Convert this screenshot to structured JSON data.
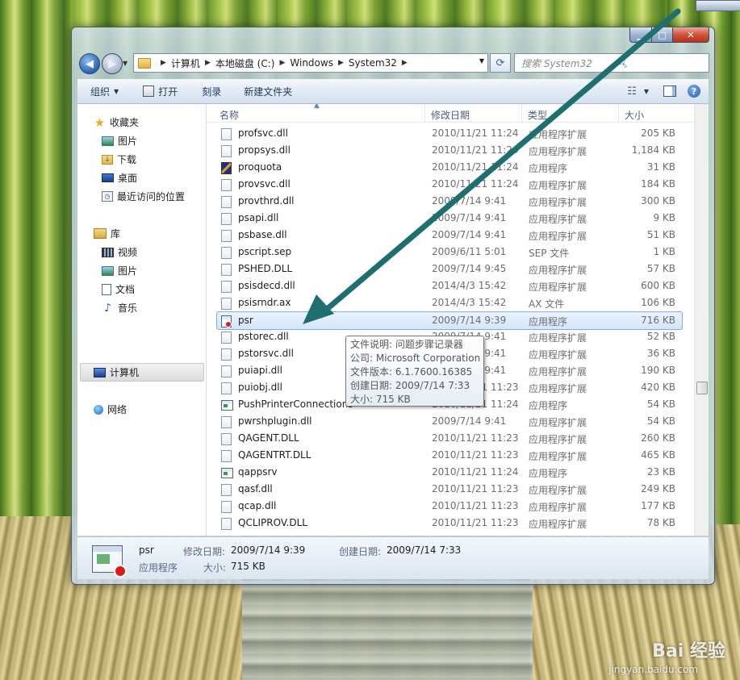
{
  "window": {
    "min_symbol": "▁",
    "max_symbol": "□",
    "close_symbol": "✕"
  },
  "address": {
    "crumbs": [
      "计算机",
      "本地磁盘 (C:)",
      "Windows",
      "System32"
    ],
    "search_placeholder": "搜索 System32"
  },
  "toolbar": {
    "organize": "组织",
    "open": "打开",
    "burn": "刻录",
    "new_folder": "新建文件夹"
  },
  "nav": {
    "favorites": "收藏夹",
    "fav_items": [
      "图片",
      "下载",
      "桌面",
      "最近访问的位置"
    ],
    "libraries": "库",
    "lib_items": [
      "视频",
      "图片",
      "文档",
      "音乐"
    ],
    "computer": "计算机",
    "network": "网络"
  },
  "columns": {
    "name": "名称",
    "date": "修改日期",
    "type": "类型",
    "size": "大小"
  },
  "files": [
    {
      "name": "profsvc.dll",
      "date": "2010/11/21 11:24",
      "type": "应用程序扩展",
      "size": "205 KB",
      "icon": "dll"
    },
    {
      "name": "propsys.dll",
      "date": "2010/11/21 11:24",
      "type": "应用程序扩展",
      "size": "1,184 KB",
      "icon": "dll"
    },
    {
      "name": "proquota",
      "date": "2010/11/21 11:24",
      "type": "应用程序",
      "size": "31 KB",
      "icon": "quota"
    },
    {
      "name": "provsvc.dll",
      "date": "2010/11/21 11:24",
      "type": "应用程序扩展",
      "size": "184 KB",
      "icon": "dll"
    },
    {
      "name": "provthrd.dll",
      "date": "2009/7/14 9:41",
      "type": "应用程序扩展",
      "size": "300 KB",
      "icon": "dll"
    },
    {
      "name": "psapi.dll",
      "date": "2009/7/14 9:41",
      "type": "应用程序扩展",
      "size": "9 KB",
      "icon": "dll"
    },
    {
      "name": "psbase.dll",
      "date": "2009/7/14 9:41",
      "type": "应用程序扩展",
      "size": "51 KB",
      "icon": "dll"
    },
    {
      "name": "pscript.sep",
      "date": "2009/6/11 5:01",
      "type": "SEP 文件",
      "size": "1 KB",
      "icon": "file"
    },
    {
      "name": "PSHED.DLL",
      "date": "2009/7/14 9:45",
      "type": "应用程序扩展",
      "size": "57 KB",
      "icon": "dll"
    },
    {
      "name": "psisdecd.dll",
      "date": "2014/4/3 15:42",
      "type": "应用程序扩展",
      "size": "600 KB",
      "icon": "dll"
    },
    {
      "name": "psisrndr.ax",
      "date": "2014/4/3 15:42",
      "type": "AX 文件",
      "size": "106 KB",
      "icon": "file"
    },
    {
      "name": "psr",
      "date": "2009/7/14 9:39",
      "type": "应用程序",
      "size": "716 KB",
      "icon": "psr",
      "selected": true
    },
    {
      "name": "pstorec.dll",
      "date": "2009/7/14 9:41",
      "type": "应用程序扩展",
      "size": "52 KB",
      "icon": "dll"
    },
    {
      "name": "pstorsvc.dll",
      "date": "2009/7/14 9:41",
      "type": "应用程序扩展",
      "size": "36 KB",
      "icon": "dll"
    },
    {
      "name": "puiapi.dll",
      "date": "2009/7/14 9:41",
      "type": "应用程序扩展",
      "size": "190 KB",
      "icon": "dll"
    },
    {
      "name": "puiobj.dll",
      "date": "2010/11/21 11:23",
      "type": "应用程序扩展",
      "size": "420 KB",
      "icon": "dll"
    },
    {
      "name": "PushPrinterConnections",
      "date": "2010/11/21 11:24",
      "type": "应用程序",
      "size": "54 KB",
      "icon": "exe"
    },
    {
      "name": "pwrshplugin.dll",
      "date": "2009/7/14 9:41",
      "type": "应用程序扩展",
      "size": "54 KB",
      "icon": "dll"
    },
    {
      "name": "QAGENT.DLL",
      "date": "2010/11/21 11:23",
      "type": "应用程序扩展",
      "size": "260 KB",
      "icon": "dll"
    },
    {
      "name": "QAGENTRT.DLL",
      "date": "2010/11/21 11:23",
      "type": "应用程序扩展",
      "size": "465 KB",
      "icon": "dll"
    },
    {
      "name": "qappsrv",
      "date": "2010/11/21 11:24",
      "type": "应用程序",
      "size": "23 KB",
      "icon": "exe"
    },
    {
      "name": "qasf.dll",
      "date": "2010/11/21 11:23",
      "type": "应用程序扩展",
      "size": "249 KB",
      "icon": "dll"
    },
    {
      "name": "qcap.dll",
      "date": "2010/11/21 11:23",
      "type": "应用程序扩展",
      "size": "177 KB",
      "icon": "dll"
    },
    {
      "name": "QCLIPROV.DLL",
      "date": "2010/11/21 11:23",
      "type": "应用程序扩展",
      "size": "78 KB",
      "icon": "dll"
    }
  ],
  "tooltip": {
    "desc": "文件说明: 问题步骤记录器",
    "company": "公司: Microsoft Corporation",
    "version": "文件版本: 6.1.7600.16385",
    "created": "创建日期: 2009/7/14 7:33",
    "size": "大小: 715 KB"
  },
  "details": {
    "name": "psr",
    "type": "应用程序",
    "modified_label": "修改日期:",
    "modified": "2009/7/14 9:39",
    "size_label": "大小:",
    "size": "715 KB",
    "created_label": "创建日期:",
    "created": "2009/7/14 7:33"
  },
  "annotation": {
    "arrow_color": "#1f6e70"
  },
  "watermark": {
    "brand": "Bai 经验",
    "url": "jingyan.baidu.com"
  }
}
